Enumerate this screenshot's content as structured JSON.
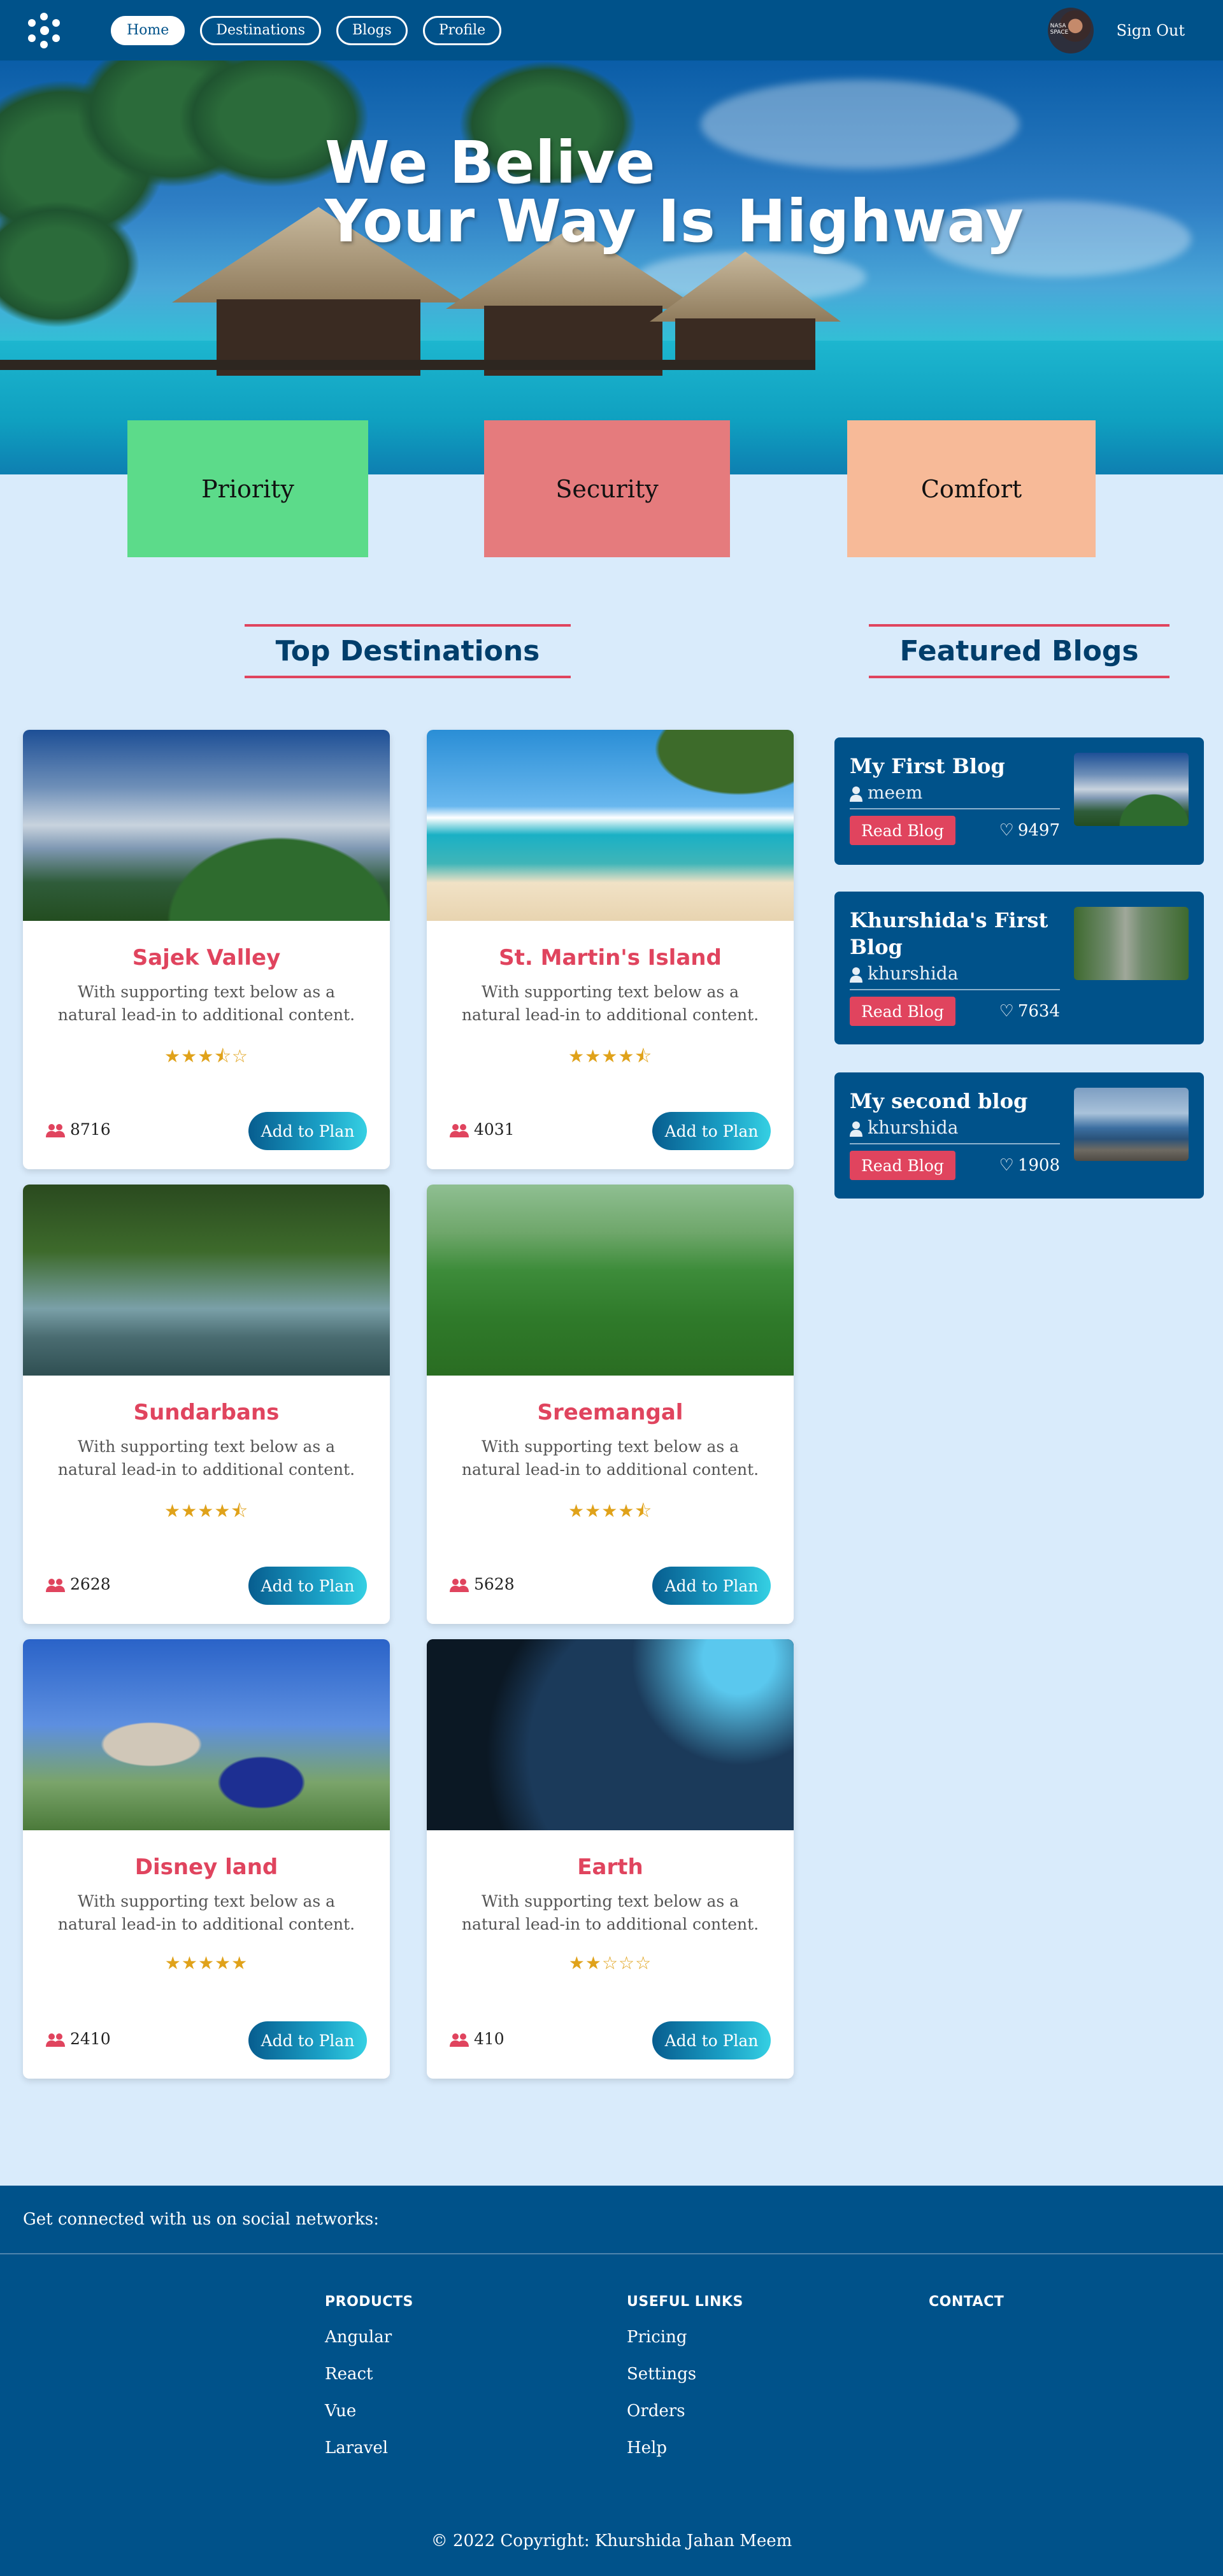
{
  "nav": {
    "links": [
      "Home",
      "Destinations",
      "Blogs",
      "Profile"
    ],
    "avatar_text": "NASA SPACE",
    "sign_out": "Sign Out"
  },
  "hero": {
    "line1": "We Belive",
    "line2": "Your Way Is Highway"
  },
  "features": [
    {
      "label": "Priority",
      "color": "#5cdb8a"
    },
    {
      "label": "Security",
      "color": "#e57b7d"
    },
    {
      "label": "Comfort",
      "color": "#f7ba98"
    }
  ],
  "sections": {
    "destinations_title": "Top Destinations",
    "blogs_title": "Featured Blogs"
  },
  "destinations": [
    {
      "name": "Sajek Valley",
      "desc": "With supporting text below as a natural lead-in to additional content.",
      "rating": 3.5,
      "visitors": "8716",
      "button": "Add to Plan",
      "image": "misty-hills"
    },
    {
      "name": "St. Martin's Island",
      "desc": "With supporting text below as a natural lead-in to additional content.",
      "rating": 4.5,
      "visitors": "4031",
      "button": "Add to Plan",
      "image": "beach-palm"
    },
    {
      "name": "Sundarbans",
      "desc": "With supporting text below as a natural lead-in to additional content.",
      "rating": 4.5,
      "visitors": "2628",
      "button": "Add to Plan",
      "image": "mangrove-deer"
    },
    {
      "name": "Sreemangal",
      "desc": "With supporting text below as a natural lead-in to additional content.",
      "rating": 4.5,
      "visitors": "5628",
      "button": "Add to Plan",
      "image": "tea-garden"
    },
    {
      "name": "Disney land",
      "desc": "With supporting text below as a natural lead-in to additional content.",
      "rating": 5,
      "visitors": "2410",
      "button": "Add to Plan",
      "image": "castle-mickey"
    },
    {
      "name": "Earth",
      "desc": "With supporting text below as a natural lead-in to additional content.",
      "rating": 2,
      "visitors": "410",
      "button": "Add to Plan",
      "image": "earth-night"
    }
  ],
  "blogs": [
    {
      "title": "My First Blog",
      "author": "meem",
      "button": "Read Blog",
      "likes": "9497",
      "image": "misty-hills"
    },
    {
      "title": "Khurshida's First Blog",
      "author": "khurshida",
      "button": "Read Blog",
      "likes": "7634",
      "image": "temple-gate"
    },
    {
      "title": "My second blog",
      "author": "khurshida",
      "button": "Read Blog",
      "likes": "1908",
      "image": "city-bridge"
    }
  ],
  "footer": {
    "social": "Get connected with us on social networks:",
    "products_title": "PRODUCTS",
    "products": [
      "Angular",
      "React",
      "Vue",
      "Laravel"
    ],
    "links_title": "USEFUL LINKS",
    "links": [
      "Pricing",
      "Settings",
      "Orders",
      "Help"
    ],
    "contact_title": "CONTACT",
    "copyright": "© 2022 Copyright: Khurshida Jahan Meem"
  }
}
